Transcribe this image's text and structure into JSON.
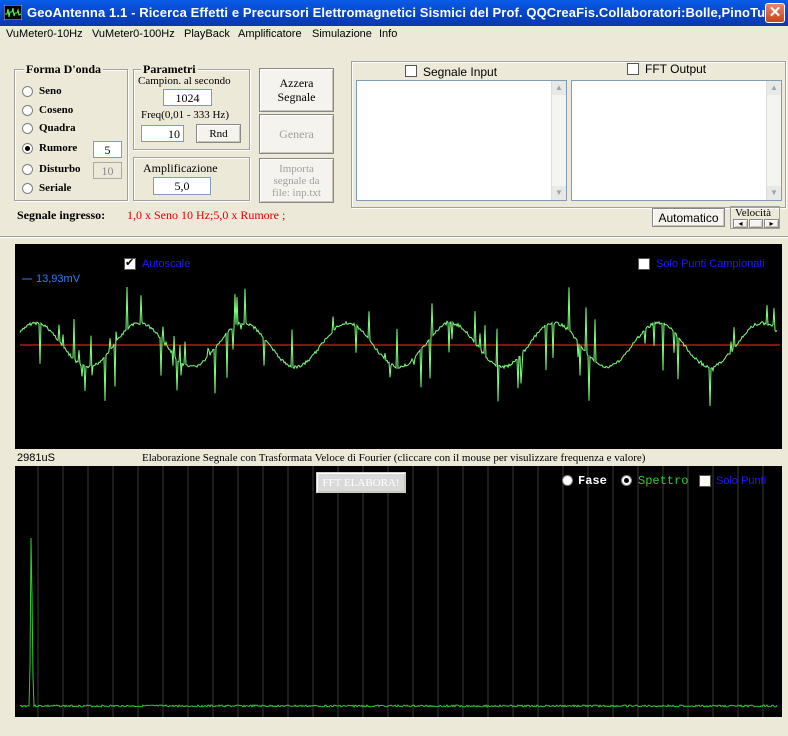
{
  "window": {
    "title": "GeoAntenna 1.1 - Ricerca Effetti e Precursori Elettromagnetici Sismici del Prof. QQCreaFis.Collaboratori:Bolle,PinoTux",
    "close_label": "✕"
  },
  "menu": [
    "VuMeter0-10Hz",
    "VuMeter0-100Hz",
    "PlayBack",
    "Amplificatore",
    "Simulazione",
    "Info"
  ],
  "forma_onda": {
    "title": "Forma D'onda",
    "options": [
      "Seno",
      "Coseno",
      "Quadra",
      "Rumore",
      "Disturbo",
      "Seriale"
    ],
    "selected": "Rumore",
    "rumore_value": "5",
    "disturbo_value": "10"
  },
  "parametri": {
    "title": "Parametri",
    "campion_label": "Campion. al secondo",
    "campion_value": "1024",
    "freq_label": "Freq(0,01 -  333  Hz)",
    "freq_value": "10",
    "rnd_label": "Rnd"
  },
  "amplificazione": {
    "label": "Amplificazione",
    "value": "5,0"
  },
  "buttons": {
    "azzera": "Azzera Segnale",
    "genera": "Genera",
    "importa": "Importa segnale da file: inp.txt",
    "automatico": "Automatico",
    "velocita": "Velocità",
    "vel_left": "◂",
    "vel_right": "▸"
  },
  "display": {
    "segnale_input_label": "Segnale Input",
    "segnale_input_checked": false,
    "fft_output_label": "FFT Output",
    "fft_output_checked": false
  },
  "signal": {
    "label": "Segnale ingresso:",
    "description": "1,0 x Seno 10 Hz;5,0 x Rumore ;"
  },
  "scope": {
    "autoscale_label": "Autoscale",
    "autoscale_checked": true,
    "solo_punti_label": "Solo Punti Campionati",
    "solo_punti_checked": false,
    "amplitude_label": "13,93mV",
    "time_label": "2981uS",
    "trace_color": "#7dff7d",
    "zero_line_color": "#ff2a2a",
    "label_color": "#1a1aff"
  },
  "fft": {
    "caption": "Elaborazione Segnale con Trasformata Veloce di Fourier (cliccare con il mouse per visulizzare frequenza e valore)",
    "elabora_label": "FFT ELABORA!",
    "fase_label": "Fase",
    "spettro_label": "Spettro",
    "mode_selected": "Spettro",
    "solo_punti_label": "Solo Punti",
    "solo_punti_checked": false,
    "peak_color": "#2ecc2e"
  },
  "colors": {
    "titlebar": "#0842c4",
    "window_bg": "#ece9d8",
    "signal_text": "#e00000"
  }
}
